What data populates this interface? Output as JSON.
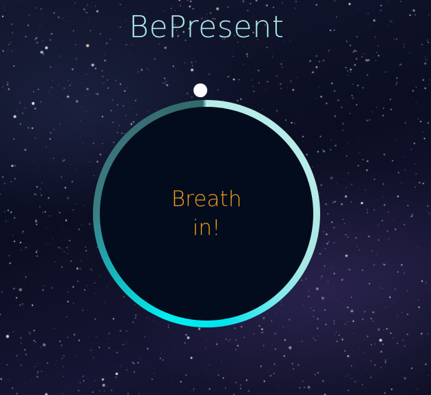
{
  "app": {
    "title": "BePresent"
  },
  "breathing": {
    "instruction": "Breath in!"
  },
  "colors": {
    "title": "#a9ecec",
    "instruction": "#f09d18",
    "circle_fill": "#020c1d",
    "ring_light": "#b8ece8",
    "ring_cyan": "#00f0f0",
    "ring_dark": "#2f6b6c",
    "pointer": "#ffffff"
  }
}
